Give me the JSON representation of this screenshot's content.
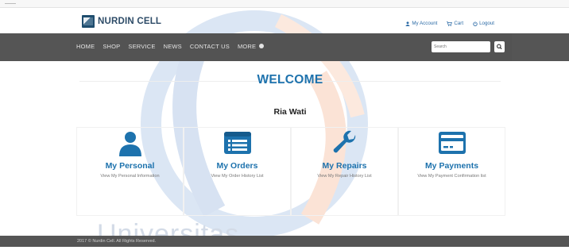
{
  "brand": {
    "name": "NURDIN CELL"
  },
  "account_links": [
    {
      "icon": "user-icon",
      "label": "My Account"
    },
    {
      "icon": "cart-icon",
      "label": "Cart"
    },
    {
      "icon": "power-icon",
      "label": "Logout"
    }
  ],
  "nav": {
    "items": [
      "HOME",
      "SHOP",
      "SERVICE",
      "NEWS",
      "CONTACT US",
      "MORE"
    ],
    "more_icon": "chevron-down-circle-icon"
  },
  "search": {
    "placeholder": "Search",
    "button_icon": "search-icon"
  },
  "main": {
    "welcome": "WELCOME",
    "user_name": "Ria Wati"
  },
  "cards": [
    {
      "icon": "person-icon",
      "title": "My Personal",
      "description": "View My Personal Information"
    },
    {
      "icon": "list-icon",
      "title": "My Orders",
      "description": "View My Order History List"
    },
    {
      "icon": "wrench-icon",
      "title": "My Repairs",
      "description": "View My Repair History List"
    },
    {
      "icon": "credit-card-icon",
      "title": "My Payments",
      "description": "View My Payment Confirmation list"
    }
  ],
  "footer": {
    "text": "2017 © Nurdin Cell. All Rights Reserved."
  },
  "watermark": {
    "text": "Universitas"
  },
  "colors": {
    "accent": "#1d72ad",
    "navbar": "#555555",
    "brand_text": "#2d4b67"
  }
}
